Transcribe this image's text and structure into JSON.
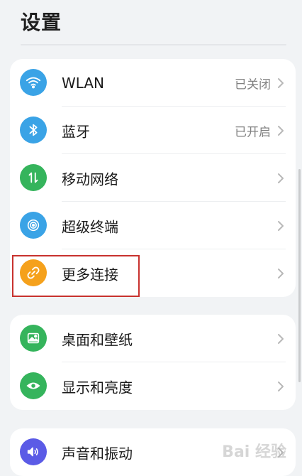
{
  "header": {
    "title": "设置"
  },
  "groups": [
    {
      "items": [
        {
          "label": "WLAN",
          "status": "已关闭",
          "icon": "wifi-icon",
          "color": "#3aa3e6"
        },
        {
          "label": "蓝牙",
          "status": "已开启",
          "icon": "bluetooth-icon",
          "color": "#3aa3e6"
        },
        {
          "label": "移动网络",
          "status": "",
          "icon": "mobile-data-icon",
          "color": "#35b45c"
        },
        {
          "label": "超级终端",
          "status": "",
          "icon": "super-device-icon",
          "color": "#3aa3e6"
        },
        {
          "label": "更多连接",
          "status": "",
          "icon": "link-icon",
          "color": "#f5a11c"
        }
      ]
    },
    {
      "items": [
        {
          "label": "桌面和壁纸",
          "icon": "wallpaper-icon",
          "color": "#35b45c"
        },
        {
          "label": "显示和亮度",
          "icon": "eye-icon",
          "color": "#35b45c"
        }
      ]
    },
    {
      "items": [
        {
          "label": "声音和振动",
          "icon": "sound-icon",
          "color": "#5b5be6"
        }
      ]
    }
  ],
  "watermark": "Bai 经验",
  "highlight_color": "#c8322e"
}
